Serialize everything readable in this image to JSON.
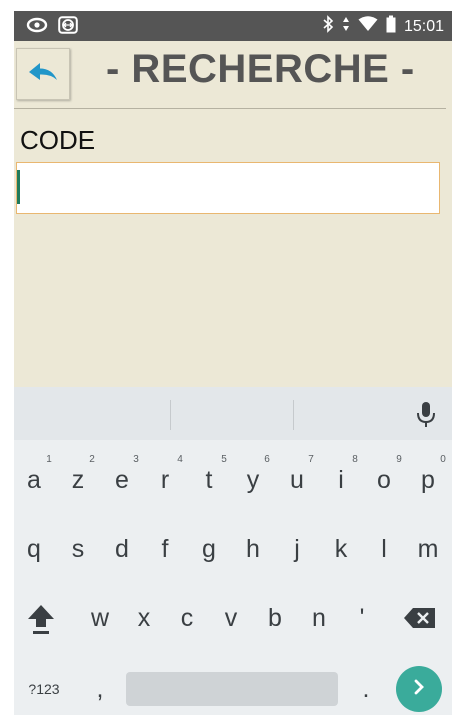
{
  "status_bar": {
    "time": "15:01",
    "icons": [
      "eye-icon",
      "teamviewer-icon",
      "bluetooth-icon",
      "data-arrows-icon",
      "wifi-icon",
      "battery-icon"
    ]
  },
  "header": {
    "title": "- RECHERCHE -",
    "back_icon": "reply-arrow-icon"
  },
  "form": {
    "code_label": "CODE",
    "code_value": ""
  },
  "keyboard": {
    "row1": [
      {
        "key": "a",
        "hint": "1"
      },
      {
        "key": "z",
        "hint": "2"
      },
      {
        "key": "e",
        "hint": "3"
      },
      {
        "key": "r",
        "hint": "4"
      },
      {
        "key": "t",
        "hint": "5"
      },
      {
        "key": "y",
        "hint": "6"
      },
      {
        "key": "u",
        "hint": "7"
      },
      {
        "key": "i",
        "hint": "8"
      },
      {
        "key": "o",
        "hint": "9"
      },
      {
        "key": "p",
        "hint": "0"
      }
    ],
    "row2": [
      "q",
      "s",
      "d",
      "f",
      "g",
      "h",
      "j",
      "k",
      "l",
      "m"
    ],
    "row3": [
      "w",
      "x",
      "c",
      "v",
      "b",
      "n",
      "'"
    ],
    "symbols_label": "?123",
    "comma": ",",
    "period": ".",
    "icons": {
      "mic": "microphone-icon",
      "shift": "shift-icon",
      "backspace": "backspace-icon",
      "enter": "chevron-right-icon"
    },
    "colors": {
      "enter": "#3aab9b",
      "background": "#eceff1"
    }
  },
  "colors": {
    "app_background": "#ece8d6",
    "status_bar": "#555555",
    "title": "#555555",
    "input_border": "#e9b770",
    "cursor": "#1f7a5c"
  }
}
